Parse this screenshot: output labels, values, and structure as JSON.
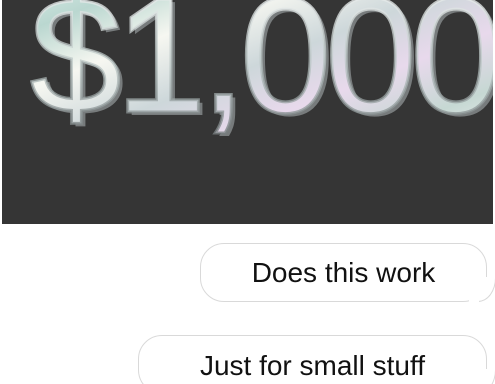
{
  "shared_image": {
    "amount_text": "$1,000",
    "background_color": "#353535"
  },
  "messages": [
    {
      "text": "Does this work",
      "bubble_color": "#ffffff",
      "border_color": "#d9d9d9"
    },
    {
      "text": "Just for small stuff",
      "bubble_color": "#ffffff",
      "border_color": "#d9d9d9"
    }
  ]
}
